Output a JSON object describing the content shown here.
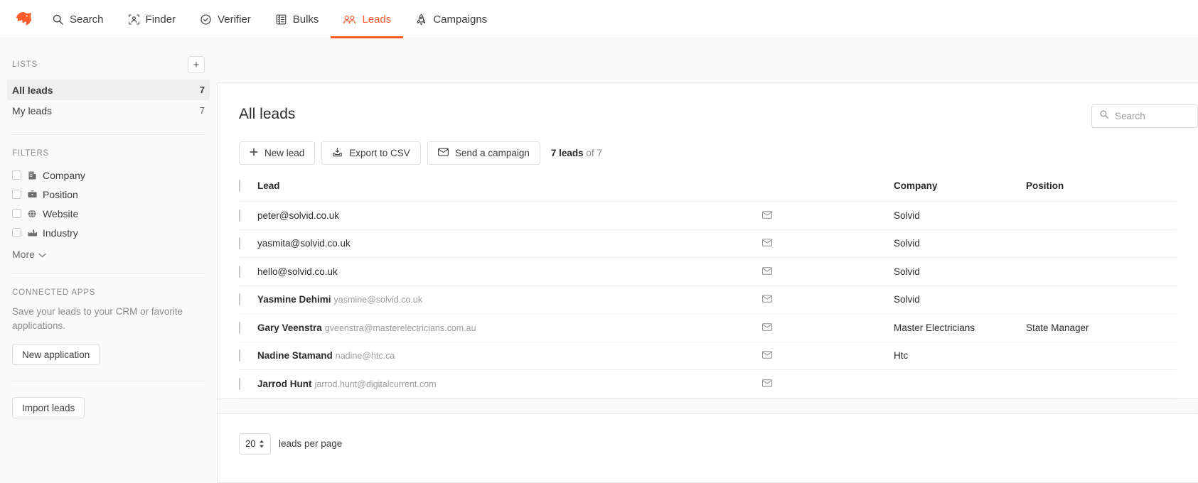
{
  "app": {
    "brand_color": "#fb5b2d",
    "logo_icon": "hunter-logo-icon"
  },
  "topnav": {
    "items": [
      {
        "label": "Search",
        "icon": "search-icon",
        "active": false
      },
      {
        "label": "Finder",
        "icon": "finder-icon",
        "active": false
      },
      {
        "label": "Verifier",
        "icon": "verifier-icon",
        "active": false
      },
      {
        "label": "Bulks",
        "icon": "bulks-icon",
        "active": false
      },
      {
        "label": "Leads",
        "icon": "leads-icon",
        "active": true
      },
      {
        "label": "Campaigns",
        "icon": "rocket-icon",
        "active": false
      }
    ]
  },
  "sidebar": {
    "lists_heading": "LISTS",
    "add_list_label": "+",
    "lists": [
      {
        "label": "All leads",
        "count": "7",
        "selected": true
      },
      {
        "label": "My leads",
        "count": "7",
        "selected": false
      }
    ],
    "filters_heading": "FILTERS",
    "filters": [
      {
        "label": "Company",
        "icon": "building-icon"
      },
      {
        "label": "Position",
        "icon": "briefcase-icon"
      },
      {
        "label": "Website",
        "icon": "globe-icon"
      },
      {
        "label": "Industry",
        "icon": "factory-icon"
      }
    ],
    "more_label": "More",
    "connected_apps_heading": "CONNECTED APPS",
    "connected_apps_text": "Save your leads to your CRM or favorite applications.",
    "new_application_label": "New application",
    "import_leads_label": "Import leads"
  },
  "main": {
    "title": "All leads",
    "search": {
      "placeholder": "Search",
      "value": ""
    },
    "toolbar": {
      "new_lead_label": "New lead",
      "export_csv_label": "Export to CSV",
      "send_campaign_label": "Send a campaign",
      "count_bold": "7 leads",
      "count_rest": "of 7"
    },
    "table": {
      "columns": [
        "Lead",
        "",
        "Company",
        "Position"
      ],
      "rows": [
        {
          "name": "",
          "email": "peter@solvid.co.uk",
          "company": "Solvid",
          "position": ""
        },
        {
          "name": "",
          "email": "yasmita@solvid.co.uk",
          "company": "Solvid",
          "position": ""
        },
        {
          "name": "",
          "email": "hello@solvid.co.uk",
          "company": "Solvid",
          "position": ""
        },
        {
          "name": "Yasmine Dehimi",
          "email": "yasmine@solvid.co.uk",
          "company": "Solvid",
          "position": ""
        },
        {
          "name": "Gary Veenstra",
          "email": "gveenstra@masterelectricians.com.au",
          "company": "Master Electricians",
          "position": "State Manager"
        },
        {
          "name": "Nadine Stamand",
          "email": "nadine@htc.ca",
          "company": "Htc",
          "position": ""
        },
        {
          "name": "Jarrod Hunt",
          "email": "jarrod.hunt@digitalcurrent.com",
          "company": "",
          "position": ""
        }
      ]
    },
    "pager": {
      "per_page_value": "20",
      "per_page_label": "leads per page"
    }
  }
}
